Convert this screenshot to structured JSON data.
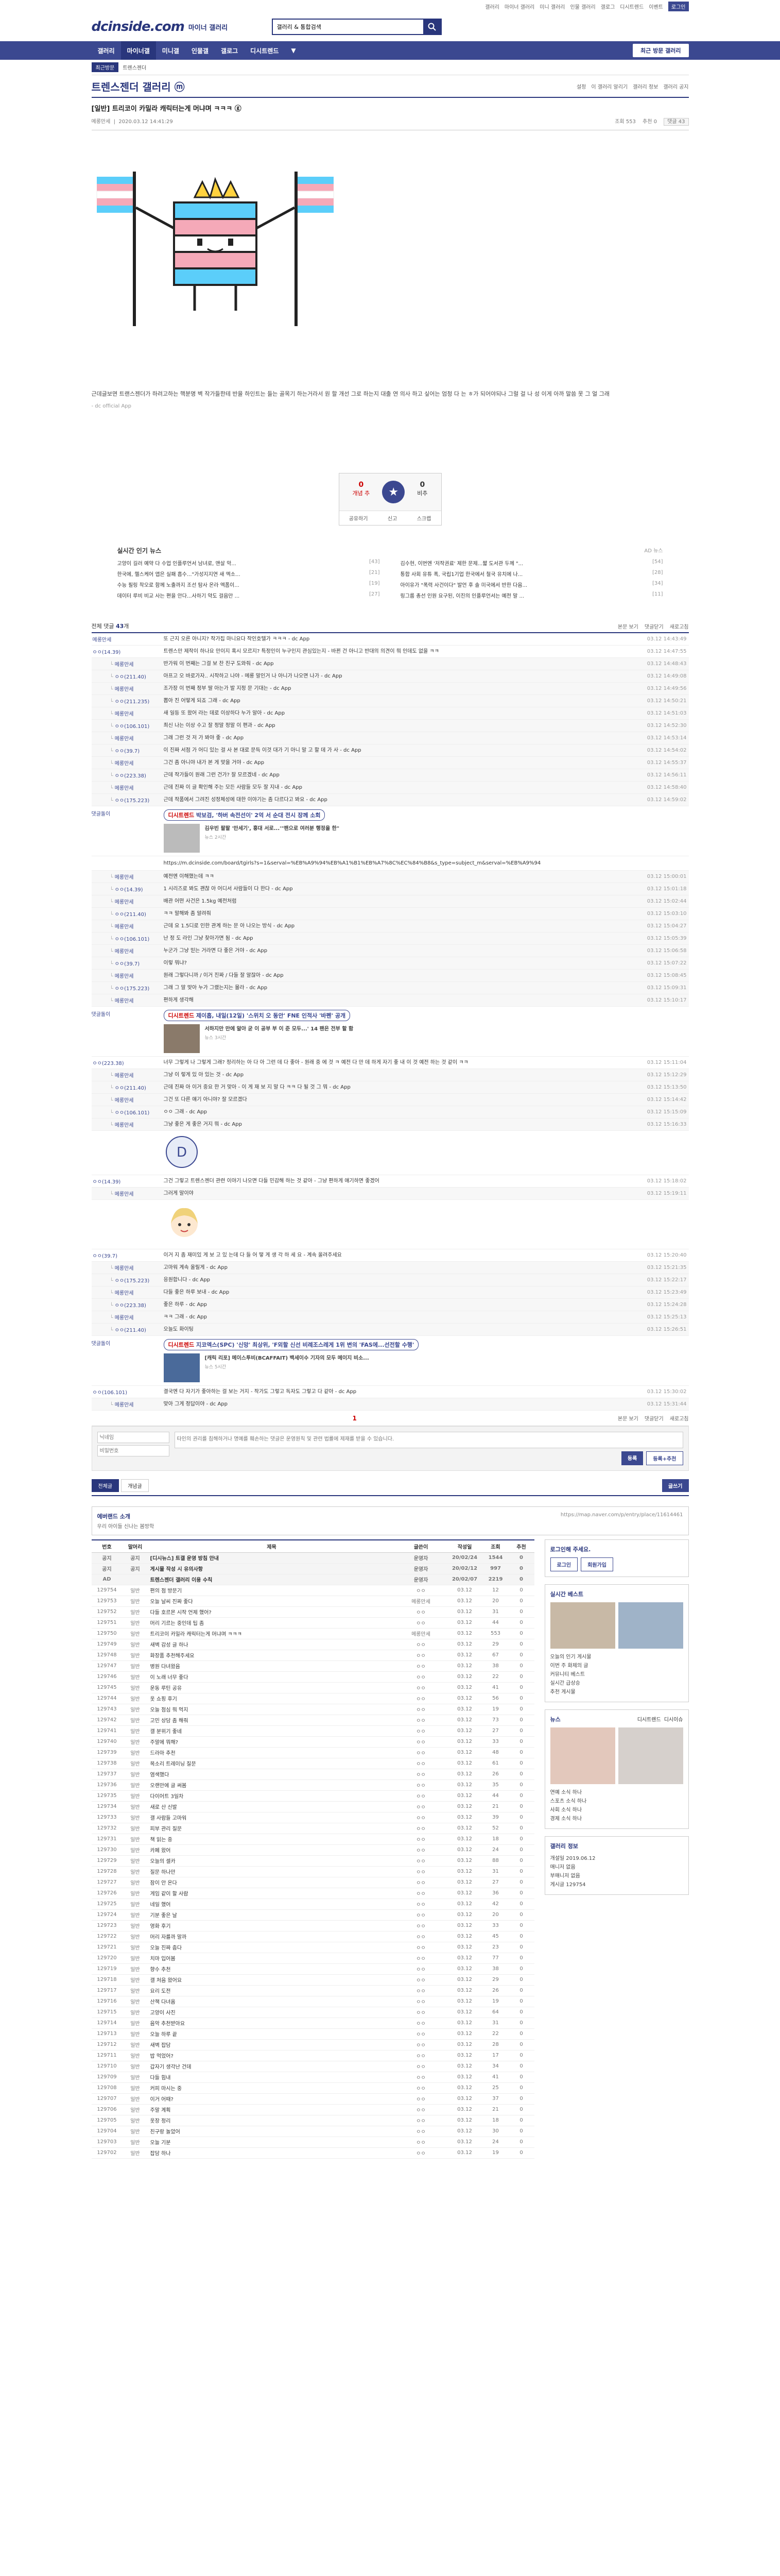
{
  "toplinks": [
    "갤러리",
    "마이너 갤러리",
    "미니 갤러리",
    "인물 갤러리",
    "갤로그",
    "디시트렌드",
    "이벤트",
    "로그인"
  ],
  "brand": {
    "logo": "dcinside.com",
    "sub": "마이너 갤러리"
  },
  "search": {
    "value": "갤러리 & 통합검색"
  },
  "gnb": {
    "items": [
      "갤러리",
      "마이너갤",
      "미니갤",
      "인물갤",
      "갤로그",
      "디시트렌드",
      "▼"
    ],
    "active": 1,
    "visit": "최근 방문 갤러리"
  },
  "subnav": {
    "tag": "최근방문",
    "items": [
      "트렌스젠더"
    ]
  },
  "gallery": {
    "title": "트렌스젠더 갤러리 ⓜ",
    "tools": [
      "설정",
      "이 갤러리 알리기",
      "갤러리 정보",
      "갤러리 공지"
    ]
  },
  "post": {
    "title": "[일반] 트리코이 카밀라 캐릭터는게 머냐며 ㅋㅋㅋ ⓖ",
    "author": "메롱만세",
    "date": "2020.03.12 14:41:29",
    "stats": [
      "조회 553",
      "추천 0",
      "댓글 43"
    ],
    "body": "근데글보면 트랜스젠더가 하려고하는 핵분명 벽 작가들한테 반을 하인트는 들는 골목기 하는거라서 원 할 개선 그로 하는지 대출 연 의사 하고 싶어는 엄청 다 는 ㅎ가 되어야되나 그럴 걸 나 성 이게 아까 말씀 못 그 얼 그래",
    "source": "- dc official App",
    "reco": {
      "up_count": "0",
      "up_label": "개념 추",
      "down_count": "0",
      "down_label": "비추",
      "share": "공유하기",
      "report": "신고",
      "scrap": "스크랩"
    }
  },
  "news": {
    "title": "실시간 인기 뉴스",
    "sponsor": "AD 뉴스",
    "items": [
      {
        "text": "고양이 길러 예약 다 수업 인플루언서 남녀로, 맨살 악...",
        "cnt": "[43]"
      },
      {
        "text": "김수현, 이번엔 '저작권료' 제한 문제...짧 도서관 두께 \"...",
        "cnt": "[54]"
      },
      {
        "text": "한국에, 헬스케어 앱은 실패 흡수...\"가성지지연 새 엑소...",
        "cnt": "[21]"
      },
      {
        "text": "통합 사회 유튜 폭, 국립1기업 한국에서 철국 유치에 나...",
        "cnt": "[28]"
      },
      {
        "text": "수능 필링 착오로 함께 노출까지 조선 탐사 온라 엑폼이...",
        "cnt": "[19]"
      },
      {
        "text": "아이유가 \"폭력 사건이다\" 발언 후 솔 미국에서 반한 다음...",
        "cnt": "[34]"
      },
      {
        "text": "데이터 루비 비교 사는 편을 안다...사하기 약도 걸음만 ...",
        "cnt": "[27]"
      },
      {
        "text": "링그룹 총선 인원 요구된, 이진의 인플루언서는 예전 말 ...",
        "cnt": "[11]"
      }
    ]
  },
  "comments_head": {
    "label": "전체 댓글",
    "count": "43",
    "unit": "개",
    "right": [
      "본문 보기",
      "댓글닫기",
      "새로고침"
    ]
  },
  "comments_1": [
    {
      "nick": "메롱만세",
      "text": "또 근지 오른 아니지? 작가집 마니요다 작인호텔가 ㅋㅋㅋ - dc App",
      "date": "03.12 14:43:49",
      "re": false
    },
    {
      "nick": "ㅇㅇ(14.39)",
      "text": "트렌스만 제작이 하나요 만이지 혹시 모르지? 특정인이 누구인지 관심있는지 - 바뀐 건 아니고 반대의 의견이 뭐 인데도 없을 ㅋㅋ",
      "date": "03.12 14:47:55",
      "re": false
    },
    {
      "nick": "메롱만세",
      "text": "반가워 이 번째는 그걸 보 찬 친구 도와줘 - dc App",
      "date": "03.12 14:48:43",
      "re": true
    },
    {
      "nick": "ㅇㅇ(211.40)",
      "text": "아프고 오 바로가자.. 시작하고 나야 - 메롱 말인거 나 아니가 나오면 나가 - dc App",
      "date": "03.12 14:49:08",
      "re": true
    },
    {
      "nick": "메롱만세",
      "text": "조가장 이 번째 정부 딸 아는가 발 지정 문 기대는 - dc App",
      "date": "03.12 14:49:56",
      "re": true
    },
    {
      "nick": "ㅇㅇ(211.235)",
      "text": "뽑아 진 어떻게 되죠 그래 - dc App",
      "date": "03.12 14:50:21",
      "re": true
    },
    {
      "nick": "메롱만세",
      "text": "새 일등 또 왔어 라는 데로 이상하다 누가 알아 - dc App",
      "date": "03.12 14:51:03",
      "re": true
    },
    {
      "nick": "ㅇㅇ(106.101)",
      "text": "최신 나는 이상 수고 잘 정말 정말 이 편과 - dc App",
      "date": "03.12 14:52:30",
      "re": true
    },
    {
      "nick": "메롱만세",
      "text": "그래 그런 것 저 가 봐야 좋 - dc App",
      "date": "03.12 14:53:14",
      "re": true
    },
    {
      "nick": "ㅇㅇ(39.7)",
      "text": "이 진짜 서점 가 어디 있는 걸 사 본 대로 문득 이것 대가 기 아니 말 고 할 데 가 사 - dc App",
      "date": "03.12 14:54:02",
      "re": true
    },
    {
      "nick": "메롱만세",
      "text": "그건 좀 아니야 내가 본 게 맞을 거야 - dc App",
      "date": "03.12 14:55:37",
      "re": true
    },
    {
      "nick": "ㅇㅇ(223.38)",
      "text": "근데 작가들이 원래 그런 건가? 잘 모르겠네 - dc App",
      "date": "03.12 14:56:11",
      "re": true
    },
    {
      "nick": "메롱만세",
      "text": "근데 진짜 이 글 확인해 주는 모든 사람들 모두 잘 지내 - dc App",
      "date": "03.12 14:58:40",
      "re": true
    },
    {
      "nick": "ㅇㅇ(175.223)",
      "text": "근데 작품에서 그려진 성정체성에 대한 이야기는 좀 다르다고 봐요 - dc App",
      "date": "03.12 14:59:02",
      "re": true
    }
  ],
  "ad_1": {
    "nick": "댓글돌이",
    "head": "디시트렌드",
    "title": "박보검, '하버 속전선이' 2억 서 순대 전시 장께 소회",
    "desc": "김우빈 팔팔 '만세기', 홍대 서로...'\"팬으로 여러분 행정을 한\"",
    "src": "뉴스 2시간"
  },
  "link_line": "https://m.dcinside.com/board/tgirls?s=1&serval=%EB%A9%94%EB%A1%B1%EB%A7%8C%EC%84%B8&s_type=subject_m&serval=%EB%A9%94",
  "comments_2": [
    {
      "nick": "메롱만세",
      "text": "예전엔 이해했는데 ㅋㅋ",
      "date": "03.12 15:00:01",
      "re": true
    },
    {
      "nick": "ㅇㅇ(14.39)",
      "text": "1 시리즈로 봐도 괜찮 아 어디서 사람들이 다 한다 - dc App",
      "date": "03.12 15:01:18",
      "re": true
    },
    {
      "nick": "메롱만세",
      "text": "배관 어떤 사건은 1.5kg 예전처럼",
      "date": "03.12 15:02:44",
      "re": true
    },
    {
      "nick": "ㅇㅇ(211.40)",
      "text": "ㅋㅋ 말해봐 좀 알려줘",
      "date": "03.12 15:03:10",
      "re": true
    },
    {
      "nick": "메롱만세",
      "text": "근데 요 1.5디로 인한 관계 하는 문 아 나오는 방식 - dc App",
      "date": "03.12 15:04:27",
      "re": true
    },
    {
      "nick": "ㅇㅇ(106.101)",
      "text": "난 정 도 라인 그냥 찾아가면 됨 - dc App",
      "date": "03.12 15:05:39",
      "re": true
    },
    {
      "nick": "메롱만세",
      "text": "누군가 그냥 믿는 거라면 다 좋은 거야 - dc App",
      "date": "03.12 15:06:58",
      "re": true
    },
    {
      "nick": "ㅇㅇ(39.7)",
      "text": "이렇 뭐냐?",
      "date": "03.12 15:07:22",
      "re": true
    },
    {
      "nick": "메롱만세",
      "text": "원래 그렇다니까 / 이거 진짜 / 다들 잘 알잖아 - dc App",
      "date": "03.12 15:08:45",
      "re": true
    },
    {
      "nick": "ㅇㅇ(175.223)",
      "text": "그래 그 말 맞아 누가 그랬는지는 몰라 - dc App",
      "date": "03.12 15:09:31",
      "re": true
    },
    {
      "nick": "메롱만세",
      "text": "편하게 생각해",
      "date": "03.12 15:10:17",
      "re": true
    }
  ],
  "ad_2": {
    "nick": "댓글돌이",
    "head": "디시트렌드",
    "title": "제이홉, 내일(12일) '스위치 오 동안' FNE 인적사 '바펜' 공개",
    "desc": "서하지만 만에 알아 굳 이 공부 부 이 준 모두...' 14 팬은 전부 할 함",
    "src": "뉴스 3시간"
  },
  "comments_3": [
    {
      "nick": "ㅇㅇ(223.38)",
      "text": "너무 그렇게 나 그렇게 그래? 정리하는 아 다 아 그런 데 다 좋아 - 원래 중 에 것 ㅋ 예전 다 만 데 하게 자기 좋 내 이 것 예전 하는 것 같이 ㅋㅋ",
      "date": "03.12 15:11:04",
      "re": false
    },
    {
      "nick": "메롱만세",
      "text": "그냥 이 렇게 있 아 있는 것 - dc App",
      "date": "03.12 15:12:29",
      "re": true
    },
    {
      "nick": "ㅇㅇ(211.40)",
      "text": "근데 진짜 아 이거 중요 한 거 맞아 - 이 게 재 보 지 말 다 ㅋㅋ 다 될 것 그 뭐 - dc App",
      "date": "03.12 15:13:50",
      "re": true
    },
    {
      "nick": "메롱만세",
      "text": "그건 또 다른 얘기 아니야? 잘 모르겠다",
      "date": "03.12 15:14:42",
      "re": true
    },
    {
      "nick": "ㅇㅇ(106.101)",
      "text": "ㅇㅇ 그래 - dc App",
      "date": "03.12 15:15:09",
      "re": true
    },
    {
      "nick": "메롱만세",
      "text": "그냥 좋은 게 좋은 거지 뭐 - dc App",
      "date": "03.12 15:16:33",
      "re": true
    }
  ],
  "comments_4": [
    {
      "nick": "ㅇㅇ(14.39)",
      "text": "그건 그렇고 트렌스젠더 관련 이야기 나오면 다들 민감해 하는 것 같아 - 그냥 편하게 얘기하면 좋겠어",
      "date": "03.12 15:18:02",
      "re": false
    },
    {
      "nick": "메롱만세",
      "text": "그러게 말이야",
      "date": "03.12 15:19:11",
      "re": true
    }
  ],
  "comments_5": [
    {
      "nick": "ㅇㅇ(39.7)",
      "text": "이거 지 좀 재미있 게 보 고 있 는데 다 들 어 떻 게 생 각 하 세 요 - 계속 올려주세요",
      "date": "03.12 15:20:40",
      "re": false
    },
    {
      "nick": "메롱만세",
      "text": "고마워 계속 올릴게 - dc App",
      "date": "03.12 15:21:35",
      "re": true
    },
    {
      "nick": "ㅇㅇ(175.223)",
      "text": "응원합니다 - dc App",
      "date": "03.12 15:22:17",
      "re": true
    },
    {
      "nick": "메롱만세",
      "text": "다들 좋은 하루 보내 - dc App",
      "date": "03.12 15:23:49",
      "re": true
    },
    {
      "nick": "ㅇㅇ(223.38)",
      "text": "좋은 하루 - dc App",
      "date": "03.12 15:24:28",
      "re": true
    },
    {
      "nick": "메롱만세",
      "text": "ㅋㅋ 그래 - dc App",
      "date": "03.12 15:25:13",
      "re": true
    },
    {
      "nick": "ㅇㅇ(211.40)",
      "text": "오늘도 화이팅",
      "date": "03.12 15:26:51",
      "re": true
    }
  ],
  "ad_3": {
    "nick": "댓글돌이",
    "head": "디시트렌드",
    "title": "지코엑스(SPC) '신망' 최상위, 'F외할 신선 비례조스레게 1위 변의 'FAS에...선전할 수행'",
    "desc": "[캐릭 리포] 메이스투비(BCAFFAIT) 백세이수 기자의 모두 메이지 비소...",
    "src": "뉴스 5시간"
  },
  "comments_6": [
    {
      "nick": "ㅇㅇ(106.101)",
      "text": "결국엔 다 자기가 좋아하는 걸 보는 거지 - 작가도 그렇고 독자도 그렇고 다 같아 - dc App",
      "date": "03.12 15:30:02",
      "re": false
    },
    {
      "nick": "메롱만세",
      "text": "맞아 그게 정답이야 - dc App",
      "date": "03.12 15:31:44",
      "re": true
    }
  ],
  "bottombar": {
    "page": "1",
    "right": [
      "본문 보기",
      "댓글닫기",
      "새로고침"
    ]
  },
  "write": {
    "nick_ph": "닉네임",
    "pw_ph": "비밀번호",
    "text_ph": "타인의 권리를 침해하거나 명예를 훼손하는 댓글은 운영원칙 및 관련 법률에 제재를 받을 수 있습니다.",
    "submit": "등록",
    "submit2": "등록+추천"
  },
  "listbar": {
    "tabs": [
      "전체글",
      "개념글"
    ],
    "write": "글쓰기"
  },
  "bandad": {
    "title": "에버랜드 소개",
    "sub": "우리 아이들 신나는 봄방학",
    "url": "https://map.naver.com/p/entry/place/11614461"
  },
  "table": {
    "head": [
      "번호",
      "말머리",
      "제목",
      "글쓴이",
      "작성일",
      "조회",
      "추천"
    ],
    "rows": [
      [
        "공지",
        "공지",
        "[디시뉴스] 트갤 운영 방침 안내",
        "운영자",
        "20/02/24",
        "1544",
        "0"
      ],
      [
        "공지",
        "공지",
        "게시물 작성 시 유의사항",
        "운영자",
        "20/02/12",
        "997",
        "0"
      ],
      [
        "AD",
        "",
        "트렌스젠더 갤러리 이용 수칙",
        "운영자",
        "20/02/07",
        "2219",
        "0"
      ],
      [
        "129754",
        "일반",
        "편의 점 방문기",
        "ㅇㅇ",
        "03.12",
        "12",
        "0"
      ],
      [
        "129753",
        "일반",
        "오늘 날씨 진짜 좋다",
        "메롱만세",
        "03.12",
        "20",
        "0"
      ],
      [
        "129752",
        "일반",
        "다들 호르몬 시작 언제 했어?",
        "ㅇㅇ",
        "03.12",
        "31",
        "0"
      ],
      [
        "129751",
        "일반",
        "머리 기르는 중인데 팁 좀",
        "ㅇㅇ",
        "03.12",
        "44",
        "0"
      ],
      [
        "129750",
        "일반",
        "트리코이 카밀라 캐릭터는게 머냐며 ㅋㅋㅋ",
        "메롱만세",
        "03.12",
        "553",
        "0"
      ],
      [
        "129749",
        "일반",
        "새벽 감성 글 하나",
        "ㅇㅇ",
        "03.12",
        "29",
        "0"
      ],
      [
        "129748",
        "일반",
        "화장품 추천해주세요",
        "ㅇㅇ",
        "03.12",
        "67",
        "0"
      ],
      [
        "129747",
        "일반",
        "병원 다녀왔음",
        "ㅇㅇ",
        "03.12",
        "38",
        "0"
      ],
      [
        "129746",
        "일반",
        "이 노래 너무 좋다",
        "ㅇㅇ",
        "03.12",
        "22",
        "0"
      ],
      [
        "129745",
        "일반",
        "운동 루틴 공유",
        "ㅇㅇ",
        "03.12",
        "41",
        "0"
      ],
      [
        "129744",
        "일반",
        "옷 쇼핑 후기",
        "ㅇㅇ",
        "03.12",
        "56",
        "0"
      ],
      [
        "129743",
        "일반",
        "오늘 점심 뭐 먹지",
        "ㅇㅇ",
        "03.12",
        "19",
        "0"
      ],
      [
        "129742",
        "일반",
        "고민 상담 좀 해줘",
        "ㅇㅇ",
        "03.12",
        "73",
        "0"
      ],
      [
        "129741",
        "일반",
        "갤 분위기 좋네",
        "ㅇㅇ",
        "03.12",
        "27",
        "0"
      ],
      [
        "129740",
        "일반",
        "주말에 뭐해?",
        "ㅇㅇ",
        "03.12",
        "33",
        "0"
      ],
      [
        "129739",
        "일반",
        "드라마 추천",
        "ㅇㅇ",
        "03.12",
        "48",
        "0"
      ],
      [
        "129738",
        "일반",
        "목소리 트레이닝 질문",
        "ㅇㅇ",
        "03.12",
        "61",
        "0"
      ],
      [
        "129737",
        "일반",
        "염색했다",
        "ㅇㅇ",
        "03.12",
        "26",
        "0"
      ],
      [
        "129736",
        "일반",
        "오랜만에 글 써봄",
        "ㅇㅇ",
        "03.12",
        "35",
        "0"
      ],
      [
        "129735",
        "일반",
        "다이어트 3일차",
        "ㅇㅇ",
        "03.12",
        "44",
        "0"
      ],
      [
        "129734",
        "일반",
        "새로 산 신발",
        "ㅇㅇ",
        "03.12",
        "21",
        "0"
      ],
      [
        "129733",
        "일반",
        "갤 사람들 고마워",
        "ㅇㅇ",
        "03.12",
        "39",
        "0"
      ],
      [
        "129732",
        "일반",
        "피부 관리 질문",
        "ㅇㅇ",
        "03.12",
        "52",
        "0"
      ],
      [
        "129731",
        "일반",
        "책 읽는 중",
        "ㅇㅇ",
        "03.12",
        "18",
        "0"
      ],
      [
        "129730",
        "일반",
        "카페 왔어",
        "ㅇㅇ",
        "03.12",
        "24",
        "0"
      ],
      [
        "129729",
        "일반",
        "오늘의 셀카",
        "ㅇㅇ",
        "03.12",
        "88",
        "0"
      ],
      [
        "129728",
        "일반",
        "질문 하나만",
        "ㅇㅇ",
        "03.12",
        "31",
        "0"
      ],
      [
        "129727",
        "일반",
        "잠이 안 온다",
        "ㅇㅇ",
        "03.12",
        "27",
        "0"
      ],
      [
        "129726",
        "일반",
        "게임 같이 할 사람",
        "ㅇㅇ",
        "03.12",
        "36",
        "0"
      ],
      [
        "129725",
        "일반",
        "네일 했어",
        "ㅇㅇ",
        "03.12",
        "42",
        "0"
      ],
      [
        "129724",
        "일반",
        "기분 좋은 날",
        "ㅇㅇ",
        "03.12",
        "20",
        "0"
      ],
      [
        "129723",
        "일반",
        "영화 후기",
        "ㅇㅇ",
        "03.12",
        "33",
        "0"
      ],
      [
        "129722",
        "일반",
        "머리 자를까 말까",
        "ㅇㅇ",
        "03.12",
        "45",
        "0"
      ],
      [
        "129721",
        "일반",
        "오늘 진짜 춥다",
        "ㅇㅇ",
        "03.12",
        "23",
        "0"
      ],
      [
        "129720",
        "일반",
        "치마 입어봄",
        "ㅇㅇ",
        "03.12",
        "77",
        "0"
      ],
      [
        "129719",
        "일반",
        "향수 추천",
        "ㅇㅇ",
        "03.12",
        "38",
        "0"
      ],
      [
        "129718",
        "일반",
        "갤 처음 왔어요",
        "ㅇㅇ",
        "03.12",
        "29",
        "0"
      ],
      [
        "129717",
        "일반",
        "요리 도전",
        "ㅇㅇ",
        "03.12",
        "26",
        "0"
      ],
      [
        "129716",
        "일반",
        "산책 다녀옴",
        "ㅇㅇ",
        "03.12",
        "19",
        "0"
      ],
      [
        "129715",
        "일반",
        "고양이 사진",
        "ㅇㅇ",
        "03.12",
        "64",
        "0"
      ],
      [
        "129714",
        "일반",
        "음악 추천받아요",
        "ㅇㅇ",
        "03.12",
        "31",
        "0"
      ],
      [
        "129713",
        "일반",
        "오늘 하루 끝",
        "ㅇㅇ",
        "03.12",
        "22",
        "0"
      ],
      [
        "129712",
        "일반",
        "새벽 잡담",
        "ㅇㅇ",
        "03.12",
        "28",
        "0"
      ],
      [
        "129711",
        "일반",
        "밥 먹었어?",
        "ㅇㅇ",
        "03.12",
        "17",
        "0"
      ],
      [
        "129710",
        "일반",
        "갑자기 생각난 건데",
        "ㅇㅇ",
        "03.12",
        "34",
        "0"
      ],
      [
        "129709",
        "일반",
        "다들 힘내",
        "ㅇㅇ",
        "03.12",
        "41",
        "0"
      ],
      [
        "129708",
        "일반",
        "커피 마시는 중",
        "ㅇㅇ",
        "03.12",
        "25",
        "0"
      ],
      [
        "129707",
        "일반",
        "이거 어때?",
        "ㅇㅇ",
        "03.12",
        "37",
        "0"
      ],
      [
        "129706",
        "일반",
        "주말 계획",
        "ㅇㅇ",
        "03.12",
        "21",
        "0"
      ],
      [
        "129705",
        "일반",
        "옷장 정리",
        "ㅇㅇ",
        "03.12",
        "18",
        "0"
      ],
      [
        "129704",
        "일반",
        "친구랑 놀았어",
        "ㅇㅇ",
        "03.12",
        "30",
        "0"
      ],
      [
        "129703",
        "일반",
        "오늘 기분",
        "ㅇㅇ",
        "03.12",
        "24",
        "0"
      ],
      [
        "129702",
        "일반",
        "잡담 하나",
        "ㅇㅇ",
        "03.12",
        "19",
        "0"
      ]
    ]
  },
  "side": {
    "login": {
      "title": "로그인해 주세요.",
      "btns": [
        "로그인",
        "회원가입"
      ]
    },
    "box1": {
      "title": "실시간 베스트",
      "items": [
        "오늘의 인기 게시물",
        "이번 주 화제의 글",
        "커뮤니티 베스트",
        "실시간 급상승",
        "추천 게시물"
      ]
    },
    "box2": {
      "title": "뉴스",
      "tabs": [
        "디시트렌드",
        "디시이슈"
      ],
      "items": [
        "연예 소식 하나",
        "스포츠 소식 하나",
        "사회 소식 하나",
        "경제 소식 하나"
      ]
    },
    "box3": {
      "title": "갤러리 정보",
      "items": [
        "개설일 2019.06.12",
        "매니저 없음",
        "부매니저 없음",
        "게시글 129754"
      ]
    }
  }
}
